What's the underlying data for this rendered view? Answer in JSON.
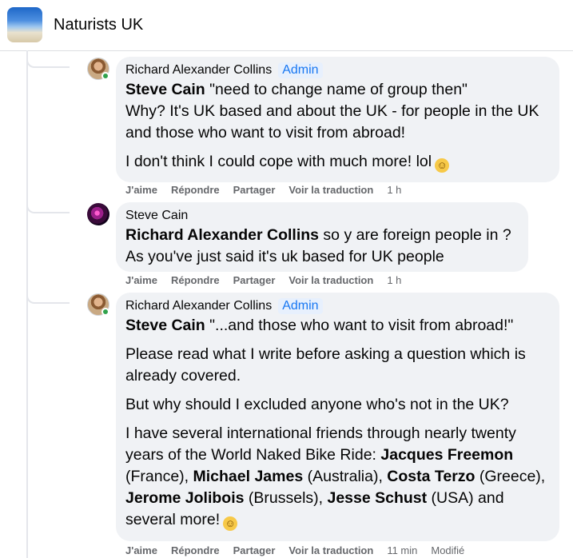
{
  "header": {
    "group_name": "Naturists UK"
  },
  "comments": [
    {
      "author": "Richard Alexander Collins",
      "badge": "Admin",
      "line1_mention": "Steve Cain",
      "line1_rest": " \"need to change name of group then\"",
      "line2": "Why? It's UK based and about the UK - for people in the UK and those who want to visit from abroad!",
      "para2": "I don't think I could cope with much more! lol",
      "emoji": "☺",
      "actions": {
        "like": "J'aime",
        "reply": "Répondre",
        "share": "Partager",
        "translate": "Voir la traduction",
        "time": "1 h"
      }
    },
    {
      "author": "Steve Cain",
      "line1_mention": "Richard Alexander Collins",
      "line1_rest": " so y are foreign people in ?",
      "line2": "As you've just said it's uk based for UK people",
      "actions": {
        "like": "J'aime",
        "reply": "Répondre",
        "share": "Partager",
        "translate": "Voir la traduction",
        "time": "1 h"
      }
    },
    {
      "author": "Richard Alexander Collins",
      "badge": "Admin",
      "line1_mention": "Steve Cain",
      "line1_rest": " \"...and those who want to visit from abroad!\"",
      "para2": "Please read what I write before asking a question which is already covered.",
      "para3": "But why should I excluded anyone who's not in the UK?",
      "para4_a": "I have several international friends through nearly twenty years of the World Naked Bike Ride: ",
      "friends": [
        {
          "name": "Jacques Freemon",
          "place": " (France), "
        },
        {
          "name": "Michael James",
          "place": " (Australia), "
        },
        {
          "name": "Costa Terzo",
          "place": " (Greece), "
        },
        {
          "name": "Jerome Jolibois",
          "place": " (Brussels), "
        },
        {
          "name": "Jesse Schust",
          "place": " (USA) and several more!"
        }
      ],
      "emoji": "☺",
      "actions": {
        "like": "J'aime",
        "reply": "Répondre",
        "share": "Partager",
        "translate": "Voir la traduction",
        "time": "11 min",
        "edited": "Modifié"
      }
    }
  ]
}
